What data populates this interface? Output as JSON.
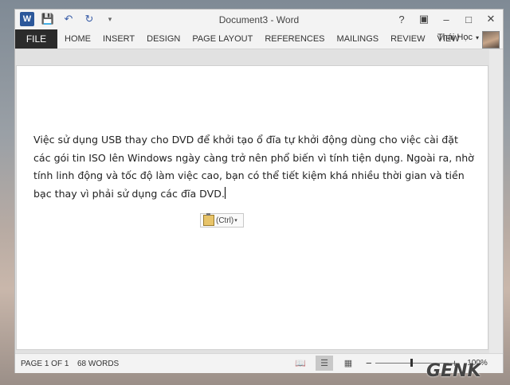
{
  "window": {
    "title": "Document3 - Word"
  },
  "qat": {
    "app_icon": "W",
    "save_icon": "save-icon",
    "undo_icon": "undo-icon",
    "redo_icon": "redo-icon",
    "customize_icon": "customize-icon"
  },
  "window_controls": {
    "help": "?",
    "ribbon_display": "ribbon-display-icon",
    "minimize": "–",
    "maximize": "□",
    "close": "✕"
  },
  "ribbon": {
    "file": "FILE",
    "tabs": [
      "HOME",
      "INSERT",
      "DESIGN",
      "PAGE LAYOUT",
      "REFERENCES",
      "MAILINGS",
      "REVIEW",
      "VIEW"
    ],
    "user": "Thái Học"
  },
  "document": {
    "paragraph": "Việc sử dụng USB thay cho DVD để khởi tạo ổ đĩa tự khởi động dùng cho việc cài đặt các gói tin ISO lên Windows ngày càng trở nên phổ biến vì tính tiện dụng. Ngoài ra, nhờ tính linh động và tốc độ làm việc cao, bạn có thể tiết kiệm khá nhiều thời gian và tiền bạc thay vì phải sử dụng các đĩa DVD."
  },
  "paste_options": {
    "label": "(Ctrl)"
  },
  "statusbar": {
    "page": "PAGE 1 OF 1",
    "words": "68 WORDS",
    "zoom_minus": "−",
    "zoom_plus": "+",
    "zoom": "100%",
    "zoom_level": 0.5
  },
  "watermark": {
    "text": "GENK"
  },
  "colors": {
    "file_tab": "#2b2b2b",
    "word_blue": "#2b579a"
  }
}
